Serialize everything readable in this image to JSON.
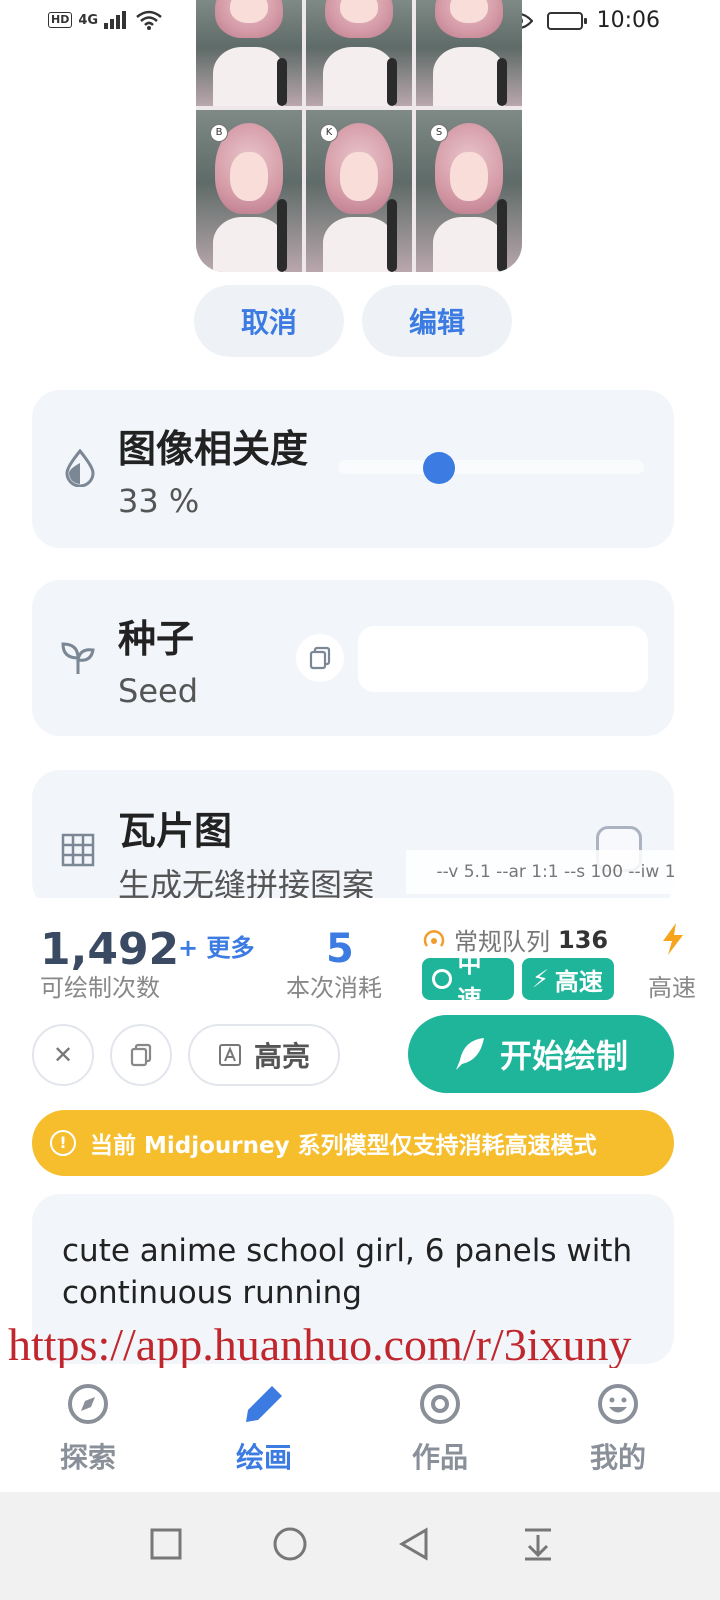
{
  "status_bar": {
    "network": "4G",
    "hd": "HD",
    "time": "10:06"
  },
  "image_preview": {
    "panels": [
      {
        "badge": ""
      },
      {
        "badge": ""
      },
      {
        "badge": ""
      },
      {
        "badge": "B"
      },
      {
        "badge": "K"
      },
      {
        "badge": "S"
      }
    ]
  },
  "preview_actions": {
    "cancel_label": "取消",
    "edit_label": "编辑"
  },
  "image_weight": {
    "title": "图像相关度",
    "value_text": "33 %",
    "value": 0.33
  },
  "seed": {
    "title": "种子",
    "subtitle": "Seed",
    "input_value": ""
  },
  "tile": {
    "title": "瓦片图",
    "subtitle": "生成无缝拼接图案",
    "checked": false
  },
  "params_preview": "--v 5.1 --ar 1:1 --s 100 --iw 1",
  "stats": {
    "remaining_count": "1,492",
    "more_label": "+ 更多",
    "remaining_label": "可绘制次数",
    "cost": "5",
    "cost_label": "本次消耗",
    "queue_label": "常规队列",
    "queue_count": "136",
    "speed_medium": "中速",
    "speed_fast": "高速",
    "mode_label": "高速"
  },
  "toolbar": {
    "highlight_label": "高亮",
    "start_label": "开始绘制"
  },
  "notice": {
    "text": "当前 Midjourney 系列模型仅支持消耗高速模式"
  },
  "prompt": {
    "text": "cute anime school girl, 6 panels with continuous running"
  },
  "watermark": "https://app.huanhuo.com/r/3ixuny",
  "tabs": [
    {
      "label": "探索",
      "icon": "compass-icon"
    },
    {
      "label": "绘画",
      "icon": "pencil-icon"
    },
    {
      "label": "作品",
      "icon": "target-icon"
    },
    {
      "label": "我的",
      "icon": "smiley-icon"
    }
  ],
  "colors": {
    "accent": "#3b7be2",
    "green": "#1fb59a",
    "notice": "#f6bd2c",
    "card": "#f2f5fa"
  }
}
